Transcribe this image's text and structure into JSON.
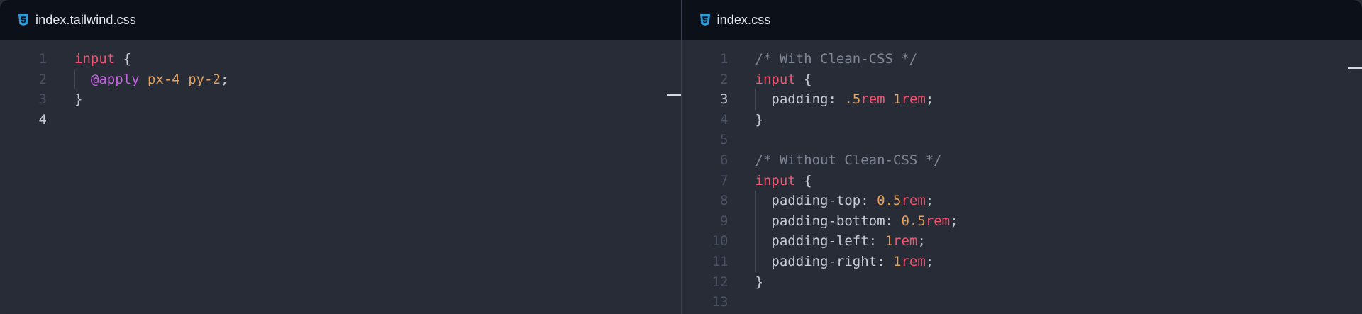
{
  "colors": {
    "tabbar": "#0b1019",
    "editor_bg": "#282c37",
    "selector": "#f0546f",
    "at_rule": "#c467e0",
    "number": "#e5a35f",
    "unit": "#f0546f",
    "comment": "#7f8696",
    "css_icon": "#2d9cdb"
  },
  "left": {
    "tab": {
      "label": "index.tailwind.css",
      "icon": "css3-icon"
    },
    "lines": [
      {
        "n": "1",
        "active": false,
        "guide": false,
        "tokens": [
          [
            "sel",
            "input"
          ],
          [
            "punc",
            " {"
          ]
        ]
      },
      {
        "n": "2",
        "active": false,
        "guide": true,
        "tokens": [
          [
            "punc",
            "  "
          ],
          [
            "at",
            "@apply"
          ],
          [
            "punc",
            " "
          ],
          [
            "cls",
            "px-4"
          ],
          [
            "punc",
            " "
          ],
          [
            "cls",
            "py-2"
          ],
          [
            "punc",
            ";"
          ]
        ]
      },
      {
        "n": "3",
        "active": false,
        "guide": false,
        "tokens": [
          [
            "punc",
            "}"
          ]
        ]
      },
      {
        "n": "4",
        "active": true,
        "guide": false,
        "tokens": []
      }
    ]
  },
  "right": {
    "tab": {
      "label": "index.css",
      "icon": "css3-icon"
    },
    "lines": [
      {
        "n": "1",
        "active": false,
        "guide": false,
        "tokens": [
          [
            "com",
            "/* With Clean-CSS */"
          ]
        ]
      },
      {
        "n": "2",
        "active": false,
        "guide": false,
        "tokens": [
          [
            "sel",
            "input"
          ],
          [
            "punc",
            " {"
          ]
        ]
      },
      {
        "n": "3",
        "active": true,
        "guide": true,
        "tokens": [
          [
            "punc",
            "  "
          ],
          [
            "prop",
            "padding"
          ],
          [
            "punc",
            ": "
          ],
          [
            "num",
            "."
          ],
          [
            "num",
            "5"
          ],
          [
            "unit",
            "rem"
          ],
          [
            "punc",
            " "
          ],
          [
            "num",
            "1"
          ],
          [
            "unit",
            "rem"
          ],
          [
            "punc",
            ";"
          ]
        ]
      },
      {
        "n": "4",
        "active": false,
        "guide": false,
        "tokens": [
          [
            "punc",
            "}"
          ]
        ]
      },
      {
        "n": "5",
        "active": false,
        "guide": false,
        "tokens": []
      },
      {
        "n": "6",
        "active": false,
        "guide": false,
        "tokens": [
          [
            "com",
            "/* Without Clean-CSS */"
          ]
        ]
      },
      {
        "n": "7",
        "active": false,
        "guide": false,
        "tokens": [
          [
            "sel",
            "input"
          ],
          [
            "punc",
            " {"
          ]
        ]
      },
      {
        "n": "8",
        "active": false,
        "guide": true,
        "tokens": [
          [
            "punc",
            "  "
          ],
          [
            "prop",
            "padding-top"
          ],
          [
            "punc",
            ": "
          ],
          [
            "num",
            "0.5"
          ],
          [
            "unit",
            "rem"
          ],
          [
            "punc",
            ";"
          ]
        ]
      },
      {
        "n": "9",
        "active": false,
        "guide": true,
        "tokens": [
          [
            "punc",
            "  "
          ],
          [
            "prop",
            "padding-bottom"
          ],
          [
            "punc",
            ": "
          ],
          [
            "num",
            "0.5"
          ],
          [
            "unit",
            "rem"
          ],
          [
            "punc",
            ";"
          ]
        ]
      },
      {
        "n": "10",
        "active": false,
        "guide": true,
        "tokens": [
          [
            "punc",
            "  "
          ],
          [
            "prop",
            "padding-left"
          ],
          [
            "punc",
            ": "
          ],
          [
            "num",
            "1"
          ],
          [
            "unit",
            "rem"
          ],
          [
            "punc",
            ";"
          ]
        ]
      },
      {
        "n": "11",
        "active": false,
        "guide": true,
        "tokens": [
          [
            "punc",
            "  "
          ],
          [
            "prop",
            "padding-right"
          ],
          [
            "punc",
            ": "
          ],
          [
            "num",
            "1"
          ],
          [
            "unit",
            "rem"
          ],
          [
            "punc",
            ";"
          ]
        ]
      },
      {
        "n": "12",
        "active": false,
        "guide": false,
        "tokens": [
          [
            "punc",
            "}"
          ]
        ]
      },
      {
        "n": "13",
        "active": false,
        "guide": false,
        "tokens": []
      }
    ]
  }
}
